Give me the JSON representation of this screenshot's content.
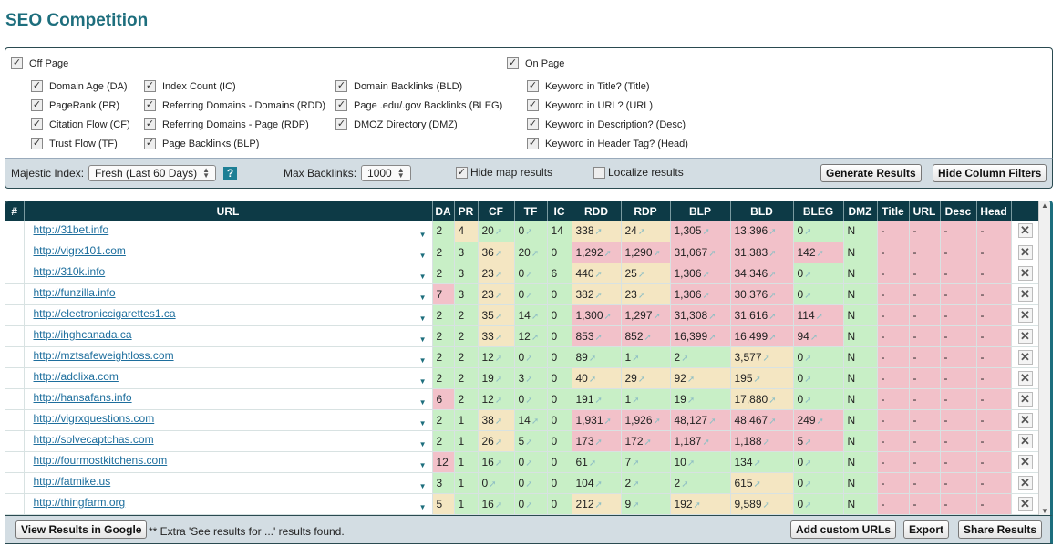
{
  "title": "SEO Competition",
  "filters": {
    "off_page": "Off Page",
    "on_page": "On Page",
    "col1": [
      "Domain Age (DA)",
      "PageRank (PR)",
      "Citation Flow (CF)",
      "Trust Flow (TF)"
    ],
    "col2": [
      "Index Count (IC)",
      "Referring Domains - Domains (RDD)",
      "Referring Domains - Page (RDP)",
      "Page Backlinks (BLP)"
    ],
    "col3": [
      "Domain Backlinks (BLD)",
      "Page .edu/.gov Backlinks (BLEG)",
      "DMOZ Directory (DMZ)"
    ],
    "col4": [
      "Keyword in Title? (Title)",
      "Keyword in URL? (URL)",
      "Keyword in Description? (Desc)",
      "Keyword in Header Tag? (Head)"
    ]
  },
  "options": {
    "index_label": "Majestic Index:",
    "index_value": "Fresh (Last 60 Days)",
    "max_label": "Max Backlinks:",
    "max_value": "1000",
    "hide_map": "Hide map results",
    "hide_map_checked": true,
    "localize": "Localize results",
    "localize_checked": false,
    "generate": "Generate Results",
    "hide_filters": "Hide Column Filters"
  },
  "colors": {
    "good": "#c8efc6",
    "warn": "#f4e6c2",
    "bad": "#f2c1c9",
    "header": "#0d3a46",
    "accent": "#1d6e7d"
  },
  "table": {
    "headers": [
      "#",
      "URL",
      "DA",
      "PR",
      "CF",
      "TF",
      "IC",
      "RDD",
      "RDP",
      "BLP",
      "BLD",
      "BLEG",
      "DMZ",
      "Title",
      "URL",
      "Desc",
      "Head"
    ],
    "rows": [
      {
        "url": "http://31bet.info",
        "v": [
          "2",
          "4",
          "20",
          "0",
          "14",
          "338",
          "24",
          "1,305",
          "13,396",
          "0",
          "N",
          "-",
          "-",
          "-",
          "-"
        ],
        "c": "gyggg yyrrg"
      },
      {
        "url": "http://vigrx101.com",
        "v": [
          "2",
          "3",
          "36",
          "20",
          "0",
          "1,292",
          "1,290",
          "31,067",
          "31,383",
          "142",
          "N",
          "-",
          "-",
          "-",
          "-"
        ],
        "c": "ggygg rrrrr"
      },
      {
        "url": "http://310k.info",
        "v": [
          "2",
          "3",
          "23",
          "0",
          "6",
          "440",
          "25",
          "1,306",
          "34,346",
          "0",
          "N",
          "-",
          "-",
          "-",
          "-"
        ],
        "c": "ggygg yyrrg"
      },
      {
        "url": "http://funzilla.info",
        "v": [
          "7",
          "3",
          "23",
          "0",
          "0",
          "382",
          "23",
          "1,306",
          "30,376",
          "0",
          "N",
          "-",
          "-",
          "-",
          "-"
        ],
        "c": "rgygg yyrrg"
      },
      {
        "url": "http://electroniccigarettes1.ca",
        "v": [
          "2",
          "2",
          "35",
          "14",
          "0",
          "1,300",
          "1,297",
          "31,308",
          "31,616",
          "114",
          "N",
          "-",
          "-",
          "-",
          "-"
        ],
        "c": "ggygg rrrrr"
      },
      {
        "url": "http://ihghcanada.ca",
        "v": [
          "2",
          "2",
          "33",
          "12",
          "0",
          "853",
          "852",
          "16,399",
          "16,499",
          "94",
          "N",
          "-",
          "-",
          "-",
          "-"
        ],
        "c": "ggygg rrrrr"
      },
      {
        "url": "http://mztsafeweightloss.com",
        "v": [
          "2",
          "2",
          "12",
          "0",
          "0",
          "89",
          "1",
          "2",
          "3,577",
          "0",
          "N",
          "-",
          "-",
          "-",
          "-"
        ],
        "c": "ggggg gggyg"
      },
      {
        "url": "http://adclixa.com",
        "v": [
          "2",
          "2",
          "19",
          "3",
          "0",
          "40",
          "29",
          "92",
          "195",
          "0",
          "N",
          "-",
          "-",
          "-",
          "-"
        ],
        "c": "ggggg yyyyg"
      },
      {
        "url": "http://hansafans.info",
        "v": [
          "6",
          "2",
          "12",
          "0",
          "0",
          "191",
          "1",
          "19",
          "17,880",
          "0",
          "N",
          "-",
          "-",
          "-",
          "-"
        ],
        "c": "rgggg gggyg"
      },
      {
        "url": "http://vigrxquestions.com",
        "v": [
          "2",
          "1",
          "38",
          "14",
          "0",
          "1,931",
          "1,926",
          "48,127",
          "48,467",
          "249",
          "N",
          "-",
          "-",
          "-",
          "-"
        ],
        "c": "ggygg rrrrr"
      },
      {
        "url": "http://solvecaptchas.com",
        "v": [
          "2",
          "1",
          "26",
          "5",
          "0",
          "173",
          "172",
          "1,187",
          "1,188",
          "5",
          "N",
          "-",
          "-",
          "-",
          "-"
        ],
        "c": "ggygg rrrrr"
      },
      {
        "url": "http://fourmostkitchens.com",
        "v": [
          "12",
          "1",
          "16",
          "0",
          "0",
          "61",
          "7",
          "10",
          "134",
          "0",
          "N",
          "-",
          "-",
          "-",
          "-"
        ],
        "c": "rgggg ggggg"
      },
      {
        "url": "http://fatmike.us",
        "v": [
          "3",
          "1",
          "0",
          "0",
          "0",
          "104",
          "2",
          "2",
          "615",
          "0",
          "N",
          "-",
          "-",
          "-",
          "-"
        ],
        "c": "ggggg gggyg"
      },
      {
        "url": "http://thingfarm.org",
        "v": [
          "5",
          "1",
          "16",
          "0",
          "0",
          "212",
          "9",
          "192",
          "9,589",
          "0",
          "N",
          "-",
          "-",
          "-",
          "-"
        ],
        "c": "ygggg ygyyg"
      }
    ]
  },
  "footer": {
    "view_google": "View Results in Google",
    "note": "** Extra 'See results for ...' results found.",
    "add_custom": "Add custom URLs",
    "export": "Export",
    "share": "Share Results"
  }
}
